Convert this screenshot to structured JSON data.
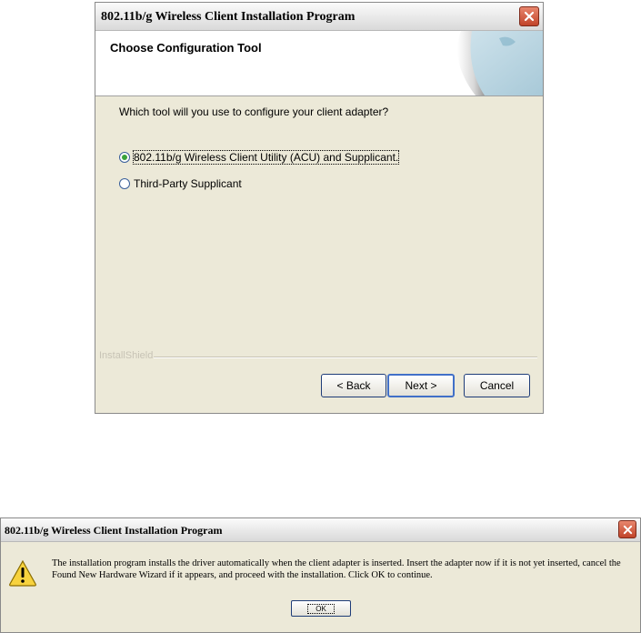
{
  "installer_dialog": {
    "title": "802.11b/g Wireless Client Installation Program",
    "header_title": "Choose Configuration Tool",
    "question": "Which tool will you use to configure your client adapter?",
    "options": [
      {
        "label": "802.11b/g Wireless Client Utility (ACU) and Supplicant.",
        "selected": true
      },
      {
        "label": "Third-Party Supplicant",
        "selected": false
      }
    ],
    "brand": "InstallShield",
    "back_button": "< Back",
    "next_button": "Next >",
    "cancel_button": "Cancel"
  },
  "message_dialog": {
    "title": "802.11b/g Wireless Client Installation Program",
    "message": "The installation program installs the driver automatically when the client adapter is inserted. Insert the adapter now if it is not yet inserted, cancel the Found New Hardware Wizard if it appears, and proceed with the installation. Click OK to continue.",
    "ok_button": "OK"
  },
  "icons": {
    "close": "close-icon",
    "warning": "warning-icon"
  },
  "colors": {
    "dialog_bg": "#ece9d8",
    "close_button": "#c1442a",
    "radio_selected": "#3aa33a",
    "default_button_border": "#4170c8"
  }
}
